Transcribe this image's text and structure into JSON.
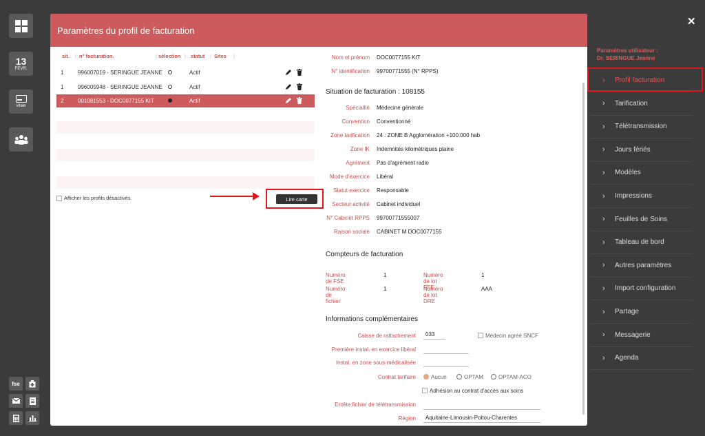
{
  "dock": {
    "date_day": "13",
    "date_month": "FÉVR.",
    "vitale_label": "vitale",
    "fse_label": "fse"
  },
  "modal": {
    "title": "Paramètres du profil de facturation"
  },
  "profiles": {
    "headers": {
      "sit": "sit.",
      "num": "n° facturation.",
      "selection": "sélection",
      "statut": "statut",
      "sites": "Sites"
    },
    "rows": [
      {
        "sit": "1",
        "num": "996007019 - SERINGUE JEANNE",
        "statut": "Actif"
      },
      {
        "sit": "1",
        "num": "996005948 - SERINGUE JEANNE",
        "statut": "Actif"
      },
      {
        "sit": "2",
        "num": "001081553 - DOC0077155 KIT",
        "statut": "Actif"
      }
    ],
    "show_disabled_label": "Afficher les profils désactivés",
    "read_card_label": "Lire carte"
  },
  "identity": {
    "name_label": "Nom et prénom",
    "name_value": "DOC0077155 KIT",
    "id_label": "N° identification",
    "id_value": "99700771555 (N° RPPS)"
  },
  "situation": {
    "title": "Situation de facturation : 108155",
    "fields": [
      {
        "k": "Spécialité",
        "v": "Médecine générale"
      },
      {
        "k": "Convention",
        "v": "Conventionné"
      },
      {
        "k": "Zone tarification",
        "v": "24 : ZONE B Agglomération +100.000 hab"
      },
      {
        "k": "Zone IK",
        "v": "Indemnités kilométriques plaine"
      },
      {
        "k": "Agrément",
        "v": "Pas d'agrément radio"
      },
      {
        "k": "Mode d'exercice",
        "v": "Libéral"
      },
      {
        "k": "Statut exercice",
        "v": "Responsable"
      },
      {
        "k": "Secteur activité",
        "v": "Cabinet individuel"
      },
      {
        "k": "N° Cabinet RPPS",
        "v": "99700771555007"
      },
      {
        "k": "Raison sociale",
        "v": "CABINET M DOC0077155"
      }
    ]
  },
  "counters": {
    "title": "Compteurs de facturation",
    "fse_label": "Numéro de FSE",
    "fse_value": "1",
    "lot_fse_label": "Numéro de lot FSE",
    "lot_fse_value": "1",
    "file_label": "Numéro de fichier",
    "file_value": "1",
    "lot_dre_label": "Numéro de lot DRE",
    "lot_dre_value": "AAA"
  },
  "extra": {
    "title": "Informations complémentaires",
    "caisse_label": "Caisse de rattachement",
    "caisse_value": "033",
    "sncf_label": "Médecin agréé SNCF",
    "first_install_label": "Première instal. en exercice libéral",
    "first_install_value": "",
    "zone_sous_med_label": "Instal. en zone sous-médicalisée",
    "zone_sous_med_value": "",
    "contrat_label": "Contrat tarifaire",
    "contrat_options": [
      "Aucun",
      "OPTAM",
      "OPTAM-ACO"
    ],
    "adhesion_label": "Adhésion au contrat d'accès aux soins",
    "entete_label": "Entête fichier de télétransmission",
    "entete_value": "",
    "region_label": "Région",
    "region_value": "Aquitaine-Limousin-Poitou-Charentes"
  },
  "right": {
    "title_line1": "Paramètres utilisateur :",
    "title_line2": "Dr. SERINGUE Jeanne",
    "menu": [
      "Profil facturation",
      "Tarification",
      "Télétransmission",
      "Jours fériés",
      "Modèles",
      "Impressions",
      "Feuilles de Soins",
      "Tableau de bord",
      "Autres paramètres",
      "Import configuration",
      "Partage",
      "Messagerie",
      "Agenda"
    ]
  },
  "colors": {
    "accent": "#cd5a5c",
    "highlight": "#e0161c",
    "background": "#3b3b3b"
  }
}
